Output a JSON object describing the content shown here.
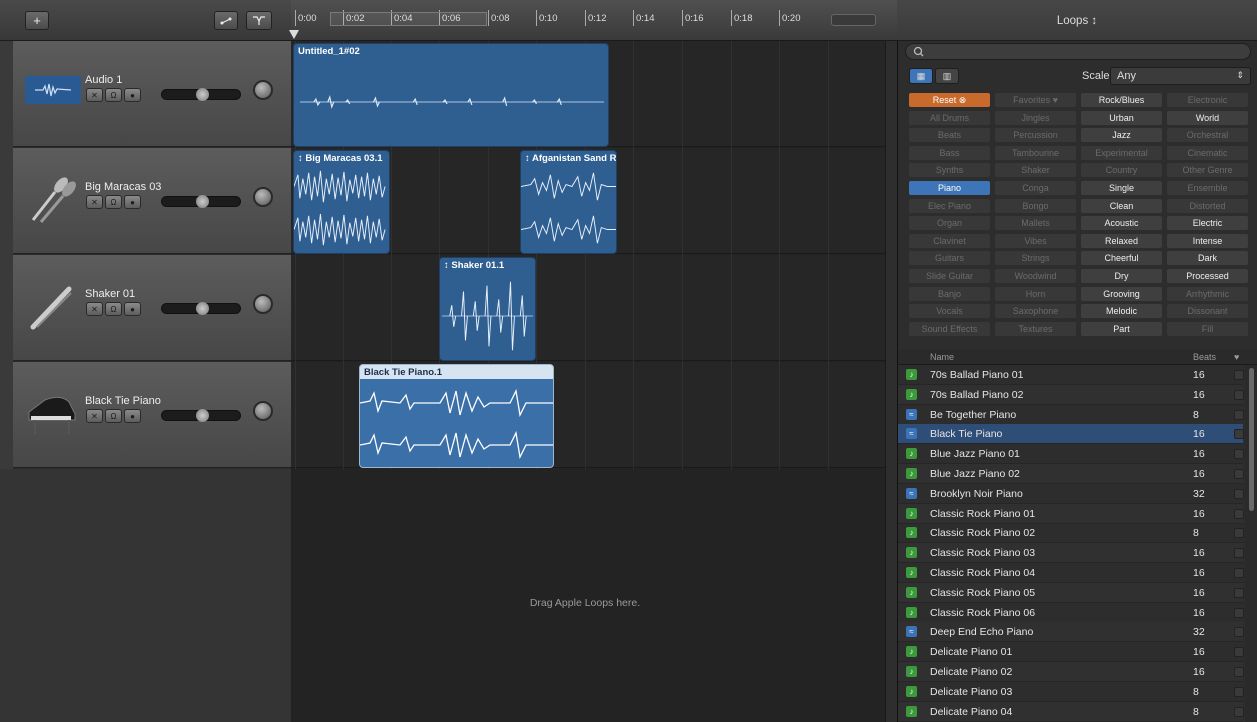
{
  "toolbar": {
    "add_label": "+"
  },
  "ruler": {
    "labels": [
      "0:00",
      "0:02",
      "0:04",
      "0:06",
      "0:08",
      "0:10",
      "0:12",
      "0:14",
      "0:16",
      "0:18",
      "0:20"
    ]
  },
  "tracks": [
    {
      "name": "Audio 1",
      "icon": "waveform-icon"
    },
    {
      "name": "Big Maracas 03",
      "icon": "maracas-icon"
    },
    {
      "name": "Shaker 01",
      "icon": "shaker-icon"
    },
    {
      "name": "Black Tie Piano",
      "icon": "grand-piano-icon"
    }
  ],
  "regions": {
    "audio1": "Untitled_1#02",
    "maracas_a": "↕ Big Maracas 03.1",
    "maracas_b": "↕ Afganistan Sand Ra",
    "shaker": "↕ Shaker 01.1",
    "piano": "Black Tie Piano.1"
  },
  "drop_hint": "Drag Apple Loops here.",
  "loops": {
    "title": "Loops ↕",
    "scale_label": "Scale:",
    "scale_value": "Any",
    "keywords": [
      [
        "Reset",
        "Favorites ♥",
        "Rock/Blues",
        "Electronic"
      ],
      [
        "All Drums",
        "Jingles",
        "Urban",
        "World"
      ],
      [
        "Beats",
        "Percussion",
        "Jazz",
        "Orchestral"
      ],
      [
        "Bass",
        "Tambourine",
        "Experimental",
        "Cinematic"
      ],
      [
        "Synths",
        "Shaker",
        "Country",
        "Other Genre"
      ],
      [
        "Piano",
        "Conga",
        "Single",
        "Ensemble"
      ],
      [
        "Elec Piano",
        "Bongo",
        "Clean",
        "Distorted"
      ],
      [
        "Organ",
        "Mallets",
        "Acoustic",
        "Electric"
      ],
      [
        "Clavinet",
        "Vibes",
        "Relaxed",
        "Intense"
      ],
      [
        "Guitars",
        "Strings",
        "Cheerful",
        "Dark"
      ],
      [
        "Slide Guitar",
        "Woodwind",
        "Dry",
        "Processed"
      ],
      [
        "Banjo",
        "Horn",
        "Grooving",
        "Arrhythmic"
      ],
      [
        "Vocals",
        "Saxophone",
        "Melodic",
        "Dissonant"
      ],
      [
        "Sound Effects",
        "Textures",
        "Part",
        "Fill"
      ]
    ],
    "list_header": {
      "name": "Name",
      "beats": "Beats",
      "fav": "♥"
    },
    "rows": [
      {
        "name": "70s Ballad Piano 01",
        "beats": "16",
        "type": "midi"
      },
      {
        "name": "70s Ballad Piano 02",
        "beats": "16",
        "type": "midi"
      },
      {
        "name": "Be Together Piano",
        "beats": "8",
        "type": "audio"
      },
      {
        "name": "Black Tie Piano",
        "beats": "16",
        "type": "audio"
      },
      {
        "name": "Blue Jazz Piano 01",
        "beats": "16",
        "type": "midi"
      },
      {
        "name": "Blue Jazz Piano 02",
        "beats": "16",
        "type": "midi"
      },
      {
        "name": "Brooklyn Noir Piano",
        "beats": "32",
        "type": "audio"
      },
      {
        "name": "Classic Rock Piano 01",
        "beats": "16",
        "type": "midi"
      },
      {
        "name": "Classic Rock Piano 02",
        "beats": "8",
        "type": "midi"
      },
      {
        "name": "Classic Rock Piano 03",
        "beats": "16",
        "type": "midi"
      },
      {
        "name": "Classic Rock Piano 04",
        "beats": "16",
        "type": "midi"
      },
      {
        "name": "Classic Rock Piano 05",
        "beats": "16",
        "type": "midi"
      },
      {
        "name": "Classic Rock Piano 06",
        "beats": "16",
        "type": "midi"
      },
      {
        "name": "Deep End Echo Piano",
        "beats": "32",
        "type": "audio"
      },
      {
        "name": "Delicate Piano 01",
        "beats": "16",
        "type": "midi"
      },
      {
        "name": "Delicate Piano 02",
        "beats": "16",
        "type": "midi"
      },
      {
        "name": "Delicate Piano 03",
        "beats": "8",
        "type": "midi"
      },
      {
        "name": "Delicate Piano 04",
        "beats": "8",
        "type": "midi"
      }
    ]
  },
  "colors": {
    "accent": "#3e74b8",
    "reset": "#c96a2d",
    "region": "#2f5e91",
    "midi": "#3b9a3b"
  }
}
